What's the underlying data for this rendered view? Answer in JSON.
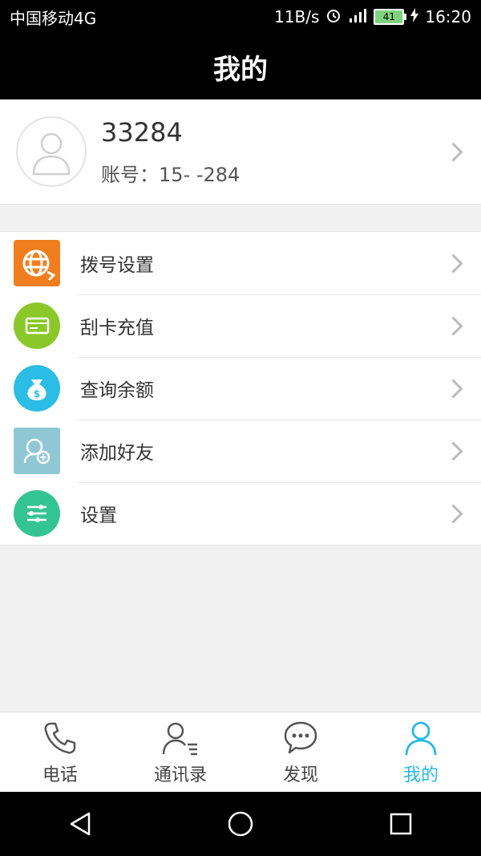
{
  "status_bar": {
    "carrier": "中国移动4G",
    "speed": "11B/s",
    "battery": "41",
    "time": "16:20"
  },
  "header": {
    "title": "我的"
  },
  "profile": {
    "name": "33284",
    "account": "账号：15-          -284"
  },
  "menu": [
    {
      "label": "拨号设置",
      "icon": "globe-icon",
      "color": "#f07e1e"
    },
    {
      "label": "刮卡充值",
      "icon": "card-icon",
      "color": "#8ac82a"
    },
    {
      "label": "查询余额",
      "icon": "money-bag-icon",
      "color": "#2bbde6"
    },
    {
      "label": "添加好友",
      "icon": "add-friend-icon",
      "color": "#8fc7d4"
    },
    {
      "label": "设置",
      "icon": "sliders-icon",
      "color": "#34c493"
    }
  ],
  "tabs": [
    {
      "label": "电话",
      "icon": "phone-icon",
      "active": false
    },
    {
      "label": "通讯录",
      "icon": "contacts-icon",
      "active": false
    },
    {
      "label": "发现",
      "icon": "chat-bubble-icon",
      "active": false
    },
    {
      "label": "我的",
      "icon": "person-icon",
      "active": true
    }
  ],
  "colors": {
    "accent": "#29b7e6",
    "header_bg": "#000000"
  }
}
